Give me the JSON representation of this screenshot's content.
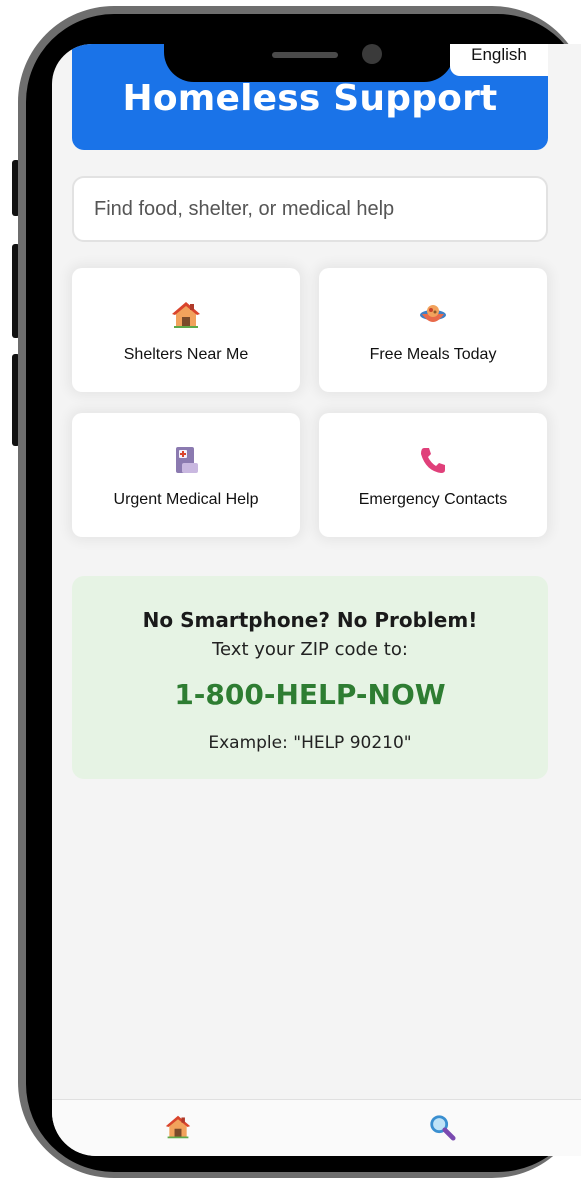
{
  "header": {
    "title": "Homeless Support",
    "language_button": "English",
    "color": "#1a73e8"
  },
  "search": {
    "placeholder": "Find food, shelter, or medical help",
    "value": ""
  },
  "quick_actions": [
    {
      "label": "Shelters Near Me",
      "icon": "house-icon"
    },
    {
      "label": "Free Meals Today",
      "icon": "food-bowl-icon"
    },
    {
      "label": "Urgent Medical Help",
      "icon": "medical-kit-icon"
    },
    {
      "label": "Emergency Contacts",
      "icon": "phone-icon"
    }
  ],
  "sms_help": {
    "title": "No Smartphone? No Problem!",
    "subtitle": "Text your ZIP code to:",
    "number": "1-800-HELP-NOW",
    "example": "Example: \"HELP 90210\"",
    "accent_color": "#2e7d32",
    "background": "#e6f3e4"
  },
  "bottom_nav": [
    {
      "icon": "house-icon"
    },
    {
      "icon": "search-icon"
    }
  ]
}
